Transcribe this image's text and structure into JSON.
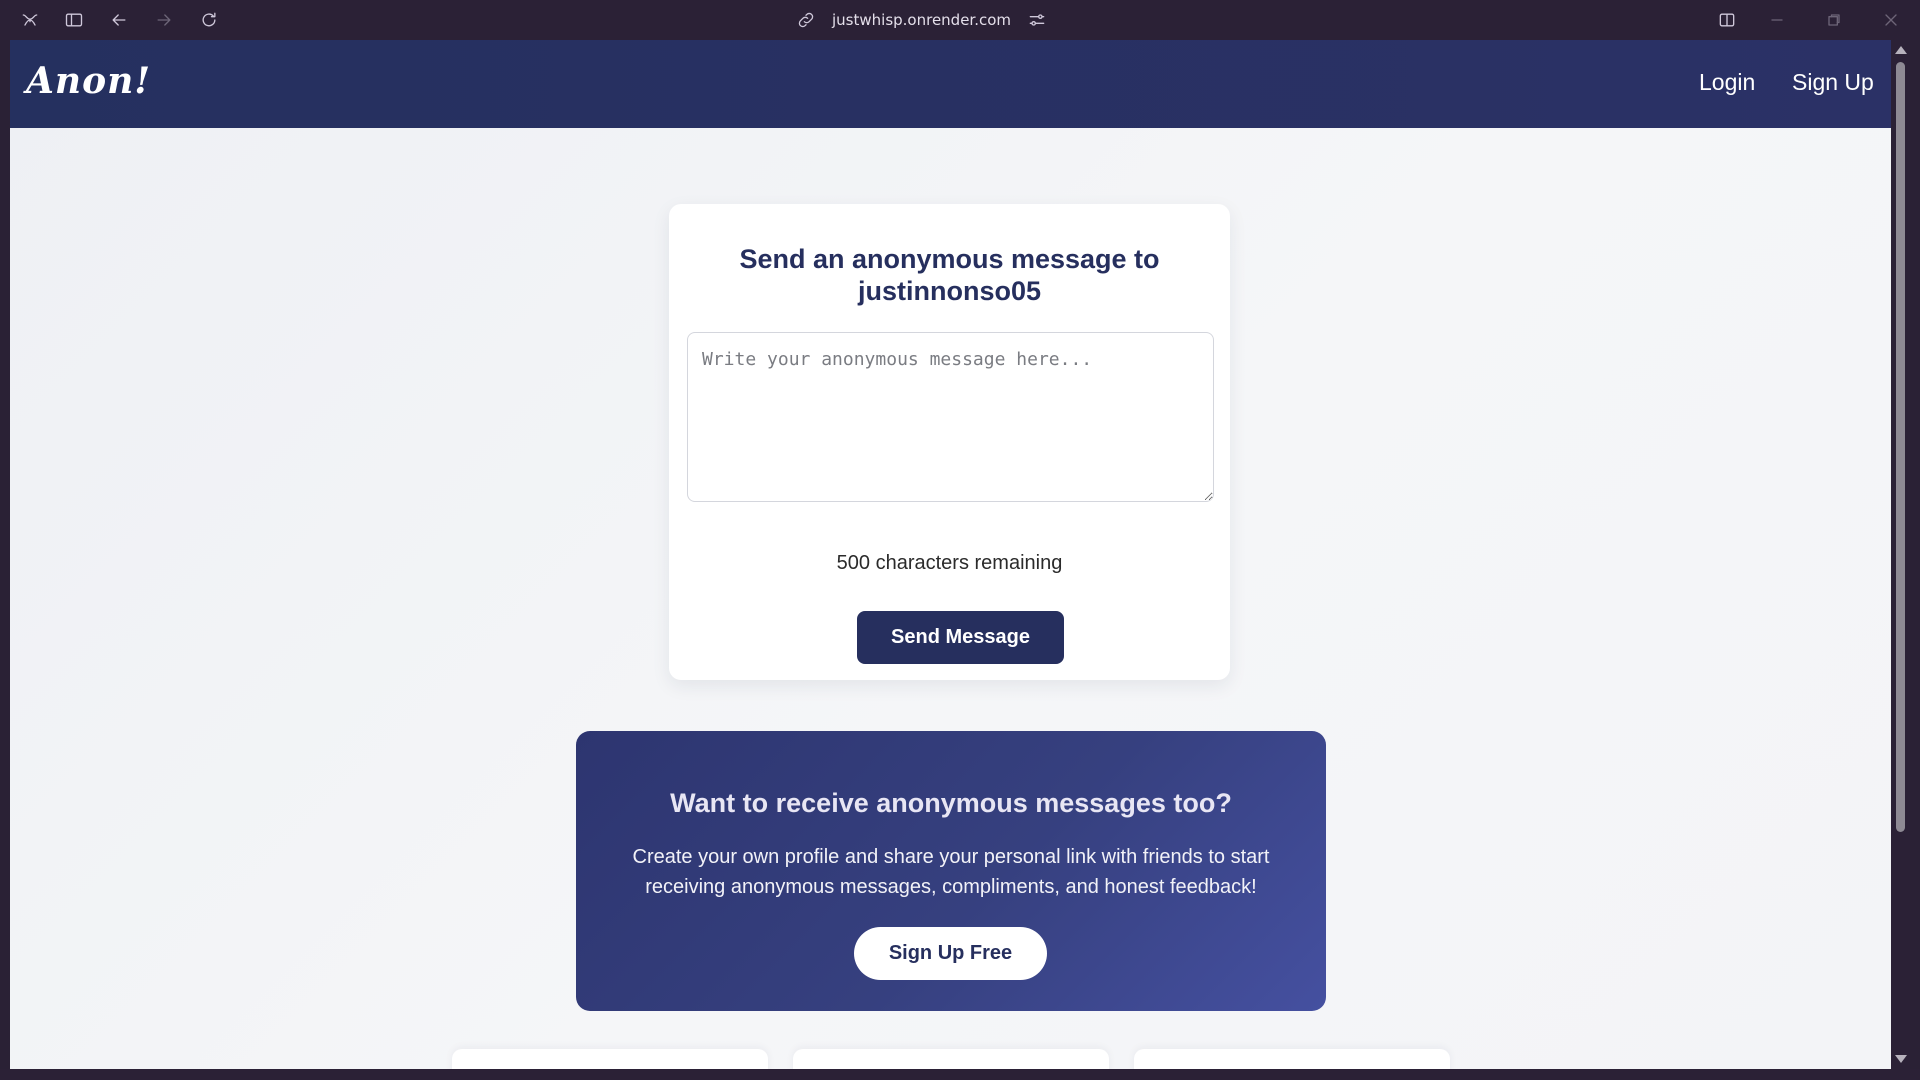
{
  "browser": {
    "url": "justwhisp.onrender.com"
  },
  "site": {
    "logo": "Anon!",
    "nav": {
      "login": "Login",
      "signup": "Sign Up"
    }
  },
  "message_card": {
    "heading_line1": "Send an anonymous message to",
    "heading_line2": "justinnonso05",
    "textarea_placeholder": "Write your anonymous message here...",
    "chars_remaining": "500 characters remaining",
    "send_button": "Send Message"
  },
  "cta": {
    "heading": "Want to receive anonymous messages too?",
    "body_line1": "Create your own profile and share your personal link with friends to start",
    "body_line2": "receiving anonymous messages, compliments, and honest feedback!",
    "button": "Sign Up Free"
  },
  "colors": {
    "navy": "#262f5e",
    "cta_start": "#2d3570",
    "cta_end": "#4550a0",
    "page_bg": "#f3f4f7"
  }
}
